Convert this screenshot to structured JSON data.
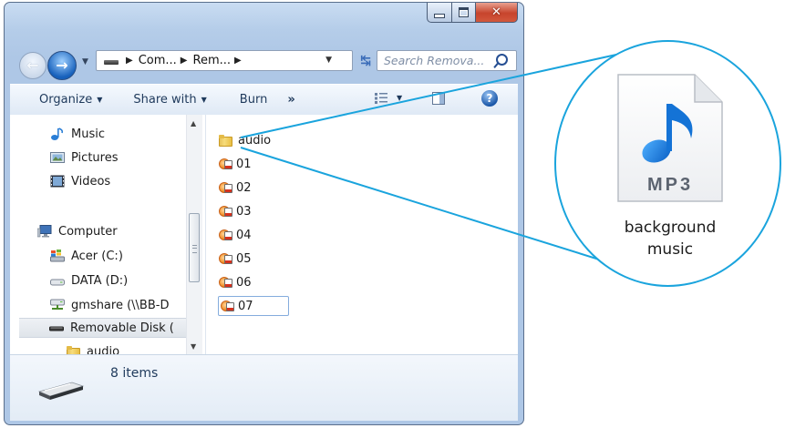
{
  "window": {
    "caption_buttons": [
      "minimize",
      "maximize",
      "close"
    ]
  },
  "address_bar": {
    "crumbs": [
      "Com...",
      "Rem..."
    ],
    "search_placeholder": "Search Remova..."
  },
  "toolbar": {
    "organize": "Organize",
    "share_with": "Share with",
    "burn": "Burn",
    "more": "»"
  },
  "nav_pane": {
    "items": [
      {
        "label": "Music",
        "icon": "music-note-icon"
      },
      {
        "label": "Pictures",
        "icon": "pictures-icon"
      },
      {
        "label": "Videos",
        "icon": "videos-icon"
      },
      {
        "label": "Computer",
        "icon": "computer-icon"
      },
      {
        "label": "Acer (C:)",
        "icon": "windows-drive-icon"
      },
      {
        "label": "DATA (D:)",
        "icon": "drive-icon"
      },
      {
        "label": "gmshare (\\\\BB-D",
        "icon": "network-drive-icon"
      },
      {
        "label": "Removable Disk (",
        "icon": "removable-disk-icon",
        "selected": true
      },
      {
        "label": "audio",
        "icon": "folder-icon"
      }
    ]
  },
  "files": [
    {
      "name": "audio",
      "type": "folder"
    },
    {
      "name": "01",
      "type": "mp3"
    },
    {
      "name": "02",
      "type": "mp3"
    },
    {
      "name": "03",
      "type": "mp3"
    },
    {
      "name": "04",
      "type": "mp3"
    },
    {
      "name": "05",
      "type": "mp3"
    },
    {
      "name": "06",
      "type": "mp3"
    },
    {
      "name": "07",
      "type": "mp3",
      "selected": true
    }
  ],
  "details": {
    "item_count": "8 items"
  },
  "callout": {
    "icon_text": "MP3",
    "label_line1": "background",
    "label_line2": "music",
    "line_color": "#1aa4dd"
  }
}
